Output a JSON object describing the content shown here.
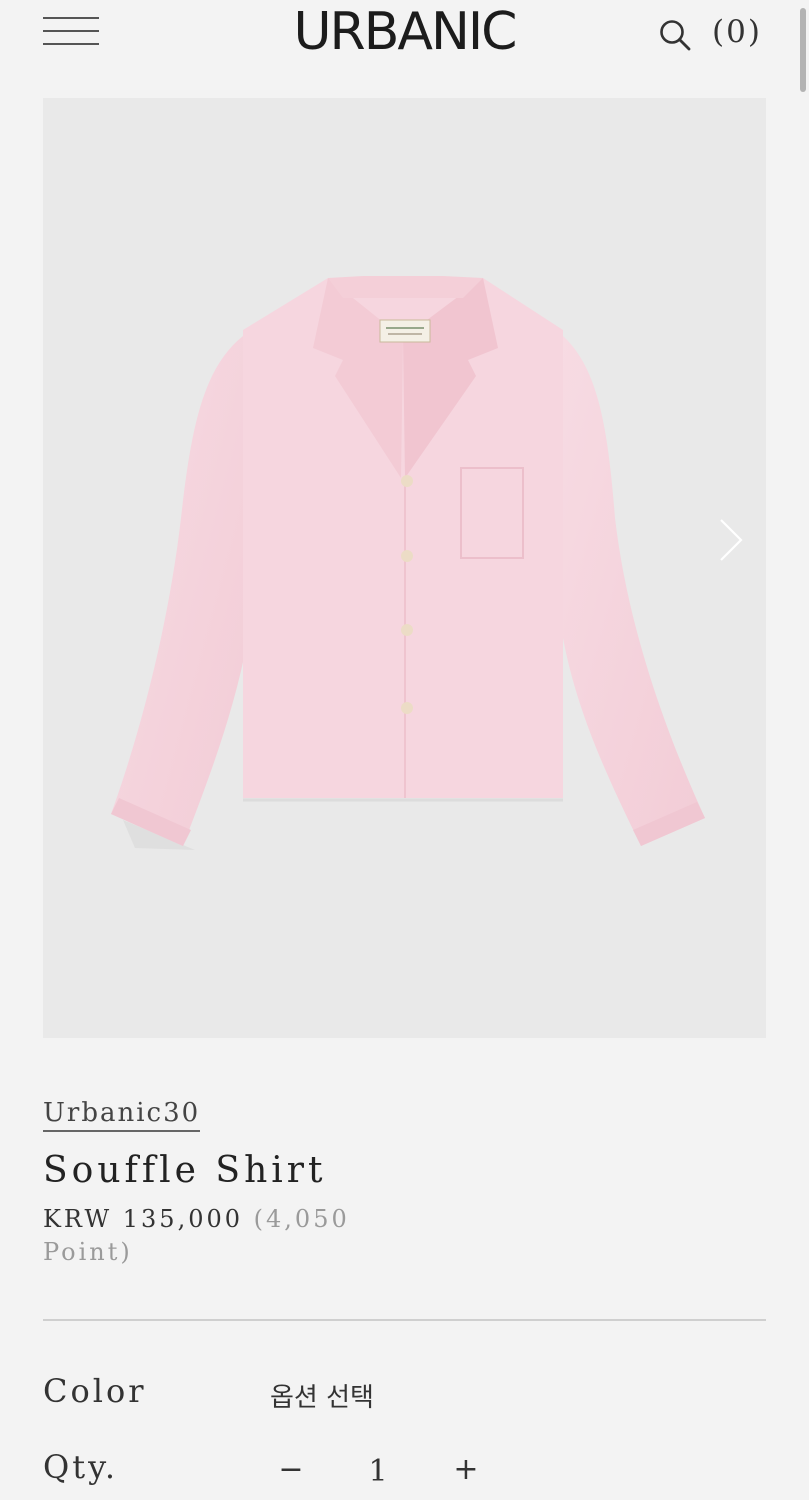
{
  "header": {
    "logo": "URBANIC",
    "cart_count": "(0)",
    "menu_icon": "hamburger-menu-icon",
    "search_icon": "search-icon"
  },
  "gallery": {
    "image_alt": "Pink long-sleeve open-collar shirt",
    "next_icon": "chevron-right-icon",
    "shirt_color": "#f5d3dc",
    "background_color": "#e9e9e9"
  },
  "product": {
    "brand": "Urbanic30",
    "name": "Souffle Shirt",
    "price": "KRW 135,000",
    "point": "(4,050 Point)"
  },
  "options": {
    "color_label": "Color",
    "color_value": "옵션 선택",
    "qty_label": "Qty.",
    "qty_minus": "−",
    "qty_value": "1",
    "qty_plus": "+"
  }
}
